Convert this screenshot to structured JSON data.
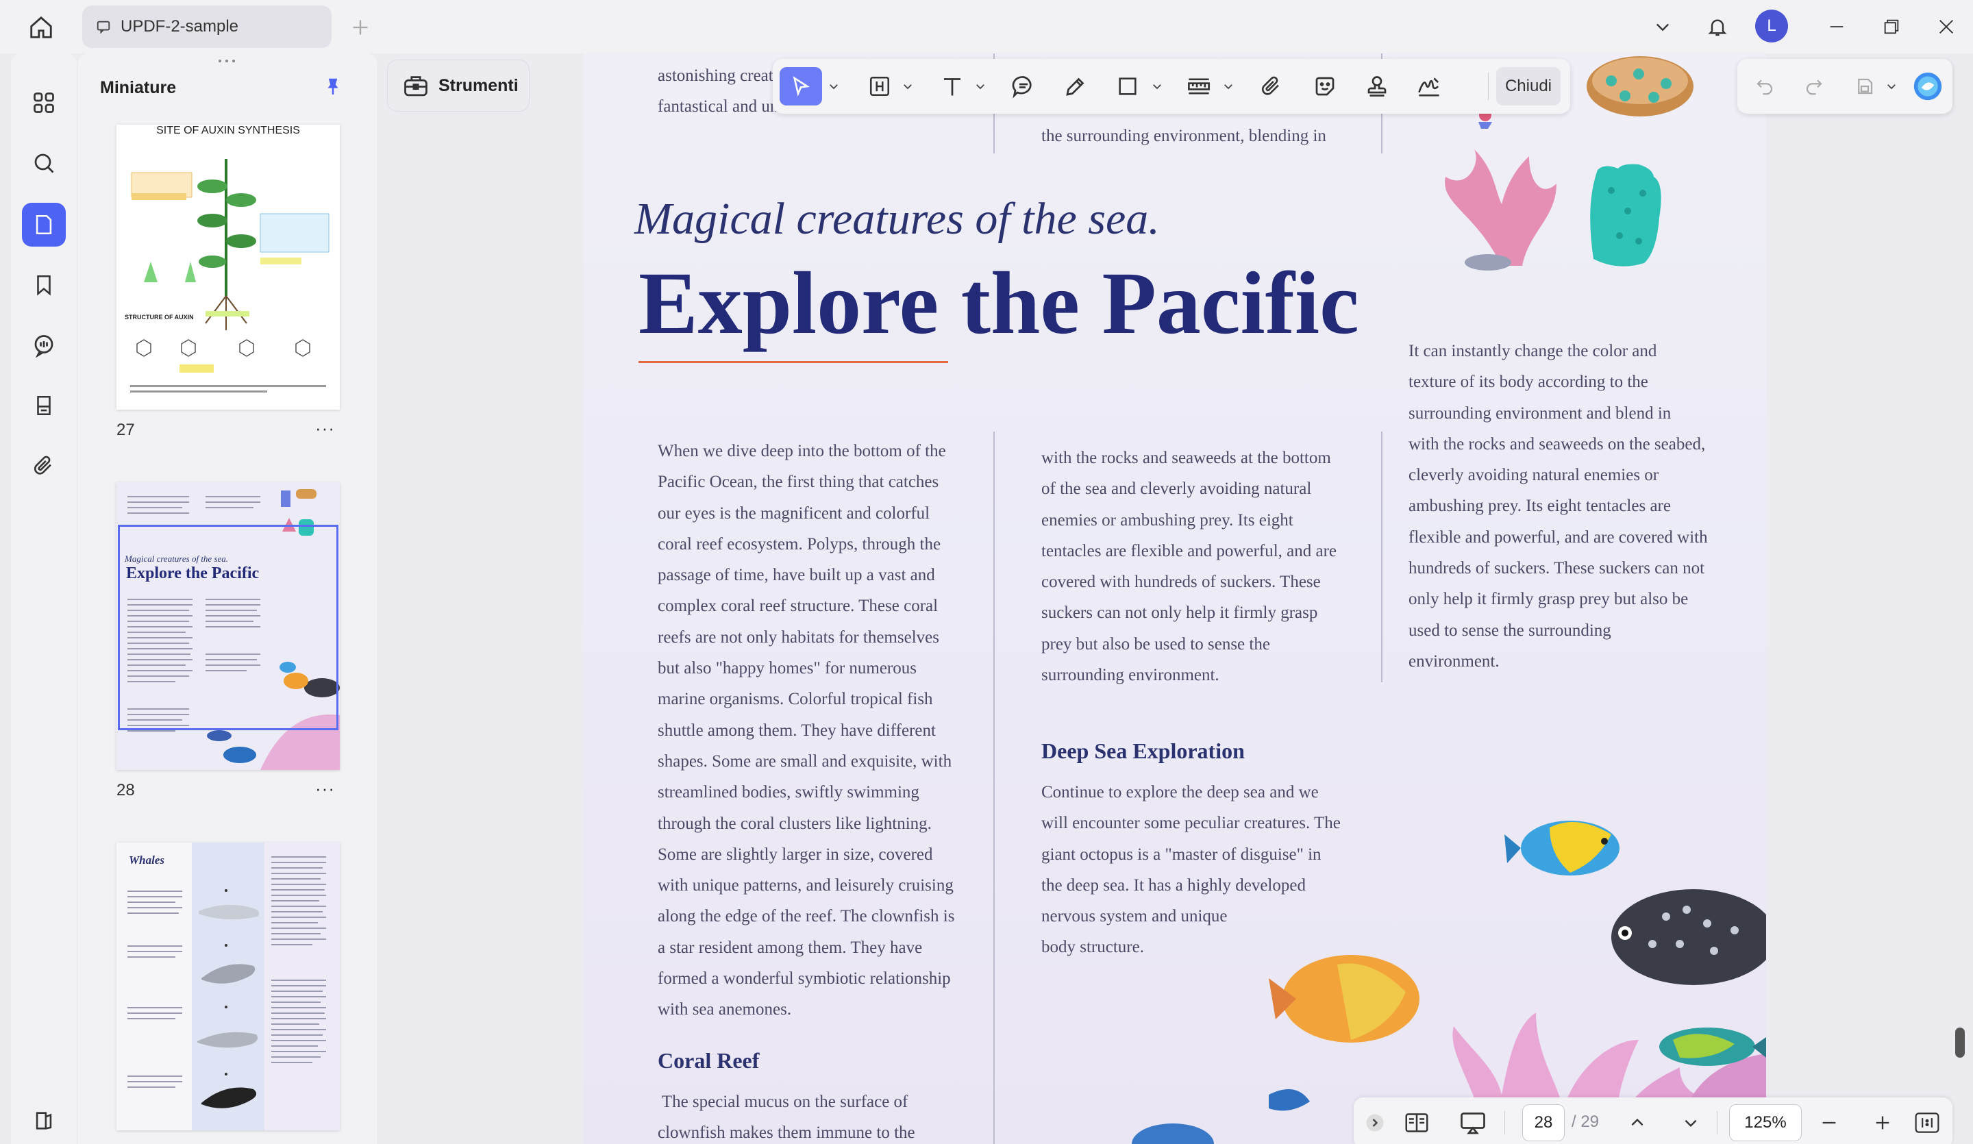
{
  "app": {
    "tab_title": "UPDF-2-sample",
    "avatar_letter": "L"
  },
  "sidebar": {
    "title": "Miniature",
    "pages": [
      {
        "number": "27",
        "more": "···",
        "mini_title": "SITE OF AUXIN SYNTHESIS",
        "mini_sub": "STRUCTURE OF AUXIN"
      },
      {
        "number": "28",
        "more": "···",
        "mini_sub": "Magical creatures of the sea.",
        "mini_title": "Explore the Pacific"
      },
      {
        "number": "",
        "more": "",
        "mini_title": "Whales"
      }
    ]
  },
  "tools_button": {
    "label": "Strumenti"
  },
  "toolbar": {
    "close_label": "Chiudi"
  },
  "document": {
    "top_left": [
      "astonishing creat",
      "fantastical and un"
    ],
    "top_center": "the surrounding environment, blending in",
    "subtitle": "Magical creatures of the sea.",
    "title": "Explore the Pacific",
    "col1_lines": [
      "When we dive deep into the bottom of the",
      "Pacific Ocean, the first thing that catches",
      "our eyes is the magnificent and colorful",
      "coral reef ecosystem. Polyps, through the",
      "passage of time, have built up a vast and",
      "complex coral reef structure. These coral",
      "reefs are not only habitats for themselves",
      "but also \"happy homes\" for numerous",
      "marine organisms. Colorful tropical fish",
      "shuttle among them. They have different",
      "shapes. Some are small and exquisite, with",
      "streamlined bodies, swiftly swimming",
      "through the coral clusters like lightning.",
      "Some are slightly larger in size, covered",
      "with unique patterns, and leisurely cruising",
      "along the edge of the reef. The clownfish is",
      "a star resident among them. They have",
      "formed a wonderful symbiotic relationship",
      "with sea anemones."
    ],
    "coral_heading": "Coral Reef",
    "coral_lines": [
      " The special mucus on the surface of",
      "clownfish makes them immune to the"
    ],
    "col2_lines": [
      "with the rocks and seaweeds at the bottom",
      "of the sea and cleverly avoiding natural",
      "enemies or ambushing prey. Its eight",
      "tentacles are flexible and powerful, and are",
      "covered with hundreds of suckers. These",
      "suckers can not only help it firmly grasp",
      "prey but also be used to sense the",
      "surrounding environment."
    ],
    "deep_heading": "Deep Sea Exploration",
    "deep_lines": [
      "Continue to explore the deep sea and we",
      "will encounter some peculiar creatures. The",
      "giant octopus is a \"master of disguise\" in",
      "the deep sea. It has a highly developed",
      "nervous system and unique",
      "body structure."
    ],
    "col3_lines": [
      "It can instantly change the color and",
      "texture of its body according to the",
      "surrounding environment and blend in",
      "with the rocks and seaweeds on the seabed,",
      "cleverly avoiding natural enemies or",
      "ambushing prey. Its eight tentacles are",
      "flexible and powerful, and are covered with",
      "hundreds of suckers. These suckers can not",
      "only help it firmly grasp prey but also be",
      "used to sense the surrounding",
      "environment."
    ]
  },
  "pager": {
    "current_page": "28",
    "total": "/ 29",
    "zoom": "125%"
  },
  "colors": {
    "accent": "#4d63f4",
    "title": "#232a78",
    "underline": "#e46a3f"
  }
}
